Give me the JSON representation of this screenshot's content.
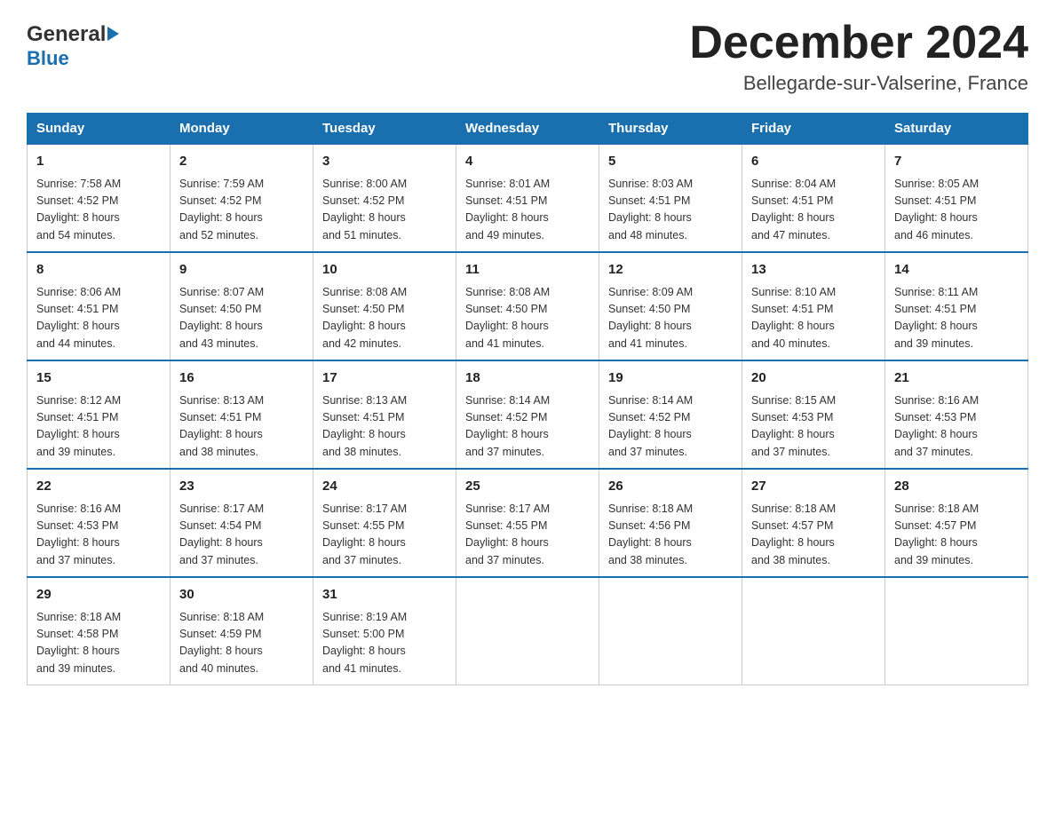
{
  "header": {
    "logo_general": "General",
    "logo_blue": "Blue",
    "month_title": "December 2024",
    "location": "Bellegarde-sur-Valserine, France"
  },
  "days_of_week": [
    "Sunday",
    "Monday",
    "Tuesday",
    "Wednesday",
    "Thursday",
    "Friday",
    "Saturday"
  ],
  "weeks": [
    [
      {
        "day": "1",
        "sunrise": "7:58 AM",
        "sunset": "4:52 PM",
        "daylight": "8 hours and 54 minutes."
      },
      {
        "day": "2",
        "sunrise": "7:59 AM",
        "sunset": "4:52 PM",
        "daylight": "8 hours and 52 minutes."
      },
      {
        "day": "3",
        "sunrise": "8:00 AM",
        "sunset": "4:52 PM",
        "daylight": "8 hours and 51 minutes."
      },
      {
        "day": "4",
        "sunrise": "8:01 AM",
        "sunset": "4:51 PM",
        "daylight": "8 hours and 49 minutes."
      },
      {
        "day": "5",
        "sunrise": "8:03 AM",
        "sunset": "4:51 PM",
        "daylight": "8 hours and 48 minutes."
      },
      {
        "day": "6",
        "sunrise": "8:04 AM",
        "sunset": "4:51 PM",
        "daylight": "8 hours and 47 minutes."
      },
      {
        "day": "7",
        "sunrise": "8:05 AM",
        "sunset": "4:51 PM",
        "daylight": "8 hours and 46 minutes."
      }
    ],
    [
      {
        "day": "8",
        "sunrise": "8:06 AM",
        "sunset": "4:51 PM",
        "daylight": "8 hours and 44 minutes."
      },
      {
        "day": "9",
        "sunrise": "8:07 AM",
        "sunset": "4:50 PM",
        "daylight": "8 hours and 43 minutes."
      },
      {
        "day": "10",
        "sunrise": "8:08 AM",
        "sunset": "4:50 PM",
        "daylight": "8 hours and 42 minutes."
      },
      {
        "day": "11",
        "sunrise": "8:08 AM",
        "sunset": "4:50 PM",
        "daylight": "8 hours and 41 minutes."
      },
      {
        "day": "12",
        "sunrise": "8:09 AM",
        "sunset": "4:50 PM",
        "daylight": "8 hours and 41 minutes."
      },
      {
        "day": "13",
        "sunrise": "8:10 AM",
        "sunset": "4:51 PM",
        "daylight": "8 hours and 40 minutes."
      },
      {
        "day": "14",
        "sunrise": "8:11 AM",
        "sunset": "4:51 PM",
        "daylight": "8 hours and 39 minutes."
      }
    ],
    [
      {
        "day": "15",
        "sunrise": "8:12 AM",
        "sunset": "4:51 PM",
        "daylight": "8 hours and 39 minutes."
      },
      {
        "day": "16",
        "sunrise": "8:13 AM",
        "sunset": "4:51 PM",
        "daylight": "8 hours and 38 minutes."
      },
      {
        "day": "17",
        "sunrise": "8:13 AM",
        "sunset": "4:51 PM",
        "daylight": "8 hours and 38 minutes."
      },
      {
        "day": "18",
        "sunrise": "8:14 AM",
        "sunset": "4:52 PM",
        "daylight": "8 hours and 37 minutes."
      },
      {
        "day": "19",
        "sunrise": "8:14 AM",
        "sunset": "4:52 PM",
        "daylight": "8 hours and 37 minutes."
      },
      {
        "day": "20",
        "sunrise": "8:15 AM",
        "sunset": "4:53 PM",
        "daylight": "8 hours and 37 minutes."
      },
      {
        "day": "21",
        "sunrise": "8:16 AM",
        "sunset": "4:53 PM",
        "daylight": "8 hours and 37 minutes."
      }
    ],
    [
      {
        "day": "22",
        "sunrise": "8:16 AM",
        "sunset": "4:53 PM",
        "daylight": "8 hours and 37 minutes."
      },
      {
        "day": "23",
        "sunrise": "8:17 AM",
        "sunset": "4:54 PM",
        "daylight": "8 hours and 37 minutes."
      },
      {
        "day": "24",
        "sunrise": "8:17 AM",
        "sunset": "4:55 PM",
        "daylight": "8 hours and 37 minutes."
      },
      {
        "day": "25",
        "sunrise": "8:17 AM",
        "sunset": "4:55 PM",
        "daylight": "8 hours and 37 minutes."
      },
      {
        "day": "26",
        "sunrise": "8:18 AM",
        "sunset": "4:56 PM",
        "daylight": "8 hours and 38 minutes."
      },
      {
        "day": "27",
        "sunrise": "8:18 AM",
        "sunset": "4:57 PM",
        "daylight": "8 hours and 38 minutes."
      },
      {
        "day": "28",
        "sunrise": "8:18 AM",
        "sunset": "4:57 PM",
        "daylight": "8 hours and 39 minutes."
      }
    ],
    [
      {
        "day": "29",
        "sunrise": "8:18 AM",
        "sunset": "4:58 PM",
        "daylight": "8 hours and 39 minutes."
      },
      {
        "day": "30",
        "sunrise": "8:18 AM",
        "sunset": "4:59 PM",
        "daylight": "8 hours and 40 minutes."
      },
      {
        "day": "31",
        "sunrise": "8:19 AM",
        "sunset": "5:00 PM",
        "daylight": "8 hours and 41 minutes."
      },
      null,
      null,
      null,
      null
    ]
  ],
  "labels": {
    "sunrise": "Sunrise: ",
    "sunset": "Sunset: ",
    "daylight": "Daylight: "
  }
}
